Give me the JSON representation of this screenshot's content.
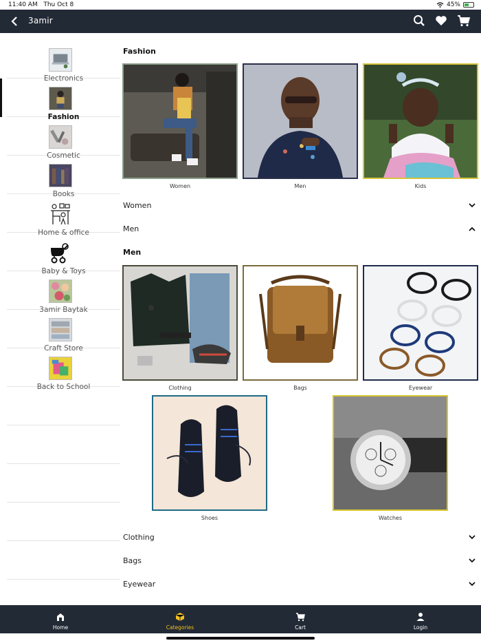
{
  "status_bar": {
    "time": "11:40 AM",
    "date": "Thu Oct 8",
    "battery": "45%"
  },
  "header": {
    "title": "3amir"
  },
  "sidebar": {
    "items": [
      {
        "label": "Electronics",
        "icon": "electronics-thumb"
      },
      {
        "label": "Fashion",
        "icon": "fashion-thumb",
        "active": true
      },
      {
        "label": "Cosmetic",
        "icon": "cosmetic-thumb"
      },
      {
        "label": "Books",
        "icon": "books-thumb"
      },
      {
        "label": "Home & office",
        "icon": "home-office-icon"
      },
      {
        "label": "Baby & Toys",
        "icon": "stroller-icon"
      },
      {
        "label": "3amir Baytak",
        "icon": "baytak-thumb"
      },
      {
        "label": "Craft Store",
        "icon": "craft-thumb"
      },
      {
        "label": "Back to School",
        "icon": "school-thumb"
      }
    ]
  },
  "content": {
    "fashion_title": "Fashion",
    "fashion_tiles": [
      {
        "caption": "Women",
        "border": "#8aa08a"
      },
      {
        "caption": "Men",
        "border": "#2a2f4a"
      },
      {
        "caption": "Kids",
        "border": "#d8c43a"
      }
    ],
    "accordion_top": [
      {
        "label": "Women",
        "chevron": "down"
      },
      {
        "label": "Men",
        "chevron": "up"
      }
    ],
    "men_title": "Men",
    "men_tiles": [
      {
        "caption": "Clothing",
        "border": "#4a4a3a"
      },
      {
        "caption": "Bags",
        "border": "#7a6a3a"
      },
      {
        "caption": "Eyewear",
        "border": "#1e2a4a"
      },
      {
        "caption": "Shoes",
        "border": "#1e6a86"
      },
      {
        "caption": "Watches",
        "border": "#d6c42e"
      }
    ],
    "accordion_bottom": [
      {
        "label": "Clothing",
        "chevron": "down"
      },
      {
        "label": "Bags",
        "chevron": "down"
      },
      {
        "label": "Eyewear",
        "chevron": "down"
      }
    ]
  },
  "tabs": [
    {
      "label": "Home",
      "icon": "home-icon"
    },
    {
      "label": "Categories",
      "icon": "categories-icon",
      "active": true
    },
    {
      "label": "Cart",
      "icon": "cart-icon"
    },
    {
      "label": "Login",
      "icon": "user-icon"
    }
  ],
  "colors": {
    "bar": "#222a36",
    "accent": "#f2c01e"
  }
}
